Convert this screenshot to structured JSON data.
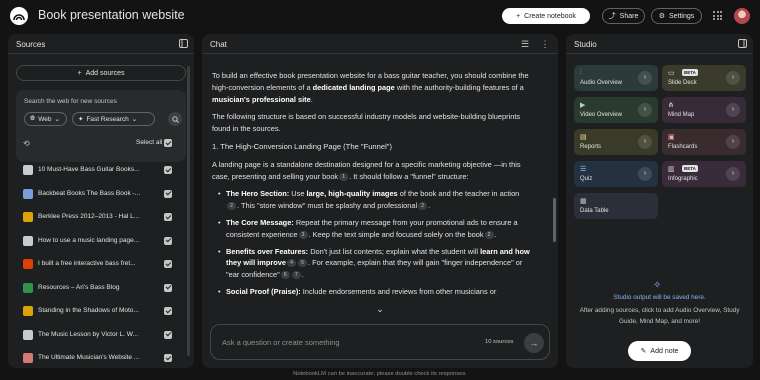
{
  "header": {
    "title": "Book presentation website",
    "create_notebook": "Create notebook",
    "share": "Share",
    "settings": "Settings"
  },
  "sources": {
    "title": "Sources",
    "add_label": "Add sources",
    "search_label": "Search the web for new sources",
    "web_chip": "Web",
    "research_chip": "Fast Research",
    "select_all": "Select all",
    "items": [
      {
        "label": "10 Must-Have Bass Guitar Books...",
        "icon": "book-icon",
        "color": "#e8eaed"
      },
      {
        "label": "Backbeat Books The Bass Book -...",
        "icon": "book-cover-icon",
        "color": "#8ab4f8"
      },
      {
        "label": "Berklee Press 2012–2013 - Hal L...",
        "icon": "pdf-icon",
        "color": "#fbbc04"
      },
      {
        "label": "How to use a music landing page...",
        "icon": "page-icon",
        "color": "#e8eaed"
      },
      {
        "label": "I built a free interactive bass fret...",
        "icon": "reddit-icon",
        "color": "#ff4500"
      },
      {
        "label": "Resources – Ari's Bass Blog",
        "icon": "blog-icon",
        "color": "#34a853"
      },
      {
        "label": "Standing in the Shadows of Moto...",
        "icon": "pdf-icon",
        "color": "#fbbc04"
      },
      {
        "label": "The Music Lesson by Victor L. W...",
        "icon": "book-cover-icon",
        "color": "#e8eaed"
      },
      {
        "label": "The Ultimate Musician's Website ...",
        "icon": "flame-icon",
        "color": "#f28b82"
      }
    ]
  },
  "chat": {
    "title": "Chat",
    "intro_a": "To build an effective book presentation website for a bass guitar teacher, you should combine the high-conversion elements of a ",
    "intro_b": "dedicated landing page",
    "intro_c": " with the authority-building features of a ",
    "intro_d": "musician's professional site",
    "intro_e": ".",
    "para2": "The following structure is based on successful industry models and website-building blueprints found in the sources.",
    "heading": "1. The High-Conversion Landing Page (The \"Funnel\")",
    "para3_a": "A landing page is a standalone destination designed for a specific marketing objective —in this case, presenting and selling your book",
    "para3_b": ". It should follow a \"funnel\" structure:",
    "cites": [
      "1",
      "2",
      "2",
      "3",
      "2",
      "4",
      "5",
      "6",
      "7"
    ],
    "b1_title": "The Hero Section:",
    "b1_a": " Use ",
    "b1_b": "large, high-quality images",
    "b1_c": " of the book and the teacher in action",
    "b1_d": ". This \"store window\" must be splashy and professional",
    "b1_e": ".",
    "b2_title": "The Core Message:",
    "b2_a": " Repeat the primary message from your promotional ads to ensure a consistent experience",
    "b2_b": ". Keep the text simple and focused solely on the book",
    "b2_c": ".",
    "b3_title": "Benefits over Features:",
    "b3_a": " Don't just list contents; explain what the student will ",
    "b3_b": "learn and how they will improve",
    "b3_c": ". For example, explain that they will gain \"finger independence\" or \"ear confidence\"",
    "b3_d": ".",
    "b4_title": "Social Proof (Praise):",
    "b4_a": " Include endorsements and reviews from other musicians or",
    "input_placeholder": "Ask a question or create something",
    "source_count": "10 sources"
  },
  "studio": {
    "title": "Studio",
    "beta": "BETA",
    "tiles": [
      {
        "label": "Audio Overview",
        "icon": "audio-waveform-icon",
        "bg": "#2c3a3a",
        "icon_color": "#a8c7fa"
      },
      {
        "label": "Slide Deck",
        "icon": "slides-icon",
        "bg": "#3a3b2a",
        "icon_color": "#e3e3e3"
      },
      {
        "label": "Video Overview",
        "icon": "video-icon",
        "bg": "#2b3a2e",
        "icon_color": "#a8dab5"
      },
      {
        "label": "Mind Map",
        "icon": "mind-map-icon",
        "bg": "#382b38",
        "icon_color": "#e3e3e3"
      },
      {
        "label": "Reports",
        "icon": "reports-icon",
        "bg": "#3a3a28",
        "icon_color": "#fde293"
      },
      {
        "label": "Flashcards",
        "icon": "flashcards-icon",
        "bg": "#3a2b2f",
        "icon_color": "#f6aea9"
      },
      {
        "label": "Quiz",
        "icon": "quiz-icon",
        "bg": "#233140",
        "icon_color": "#a8c7fa"
      },
      {
        "label": "Infographic",
        "icon": "infographic-icon",
        "bg": "#3a2b3a",
        "icon_color": "#e3e3e3"
      },
      {
        "label": "Data Table",
        "icon": "table-icon",
        "bg": "#2b2f3a",
        "icon_color": "#c4c7c5"
      }
    ],
    "empty_title": "Studio output will be saved here.",
    "empty_desc": "After adding sources, click to add Audio Overview, Study Guide, Mind Map, and more!",
    "add_note": "Add note"
  },
  "footer": "NotebookLM can be inaccurate; please double check its responses."
}
